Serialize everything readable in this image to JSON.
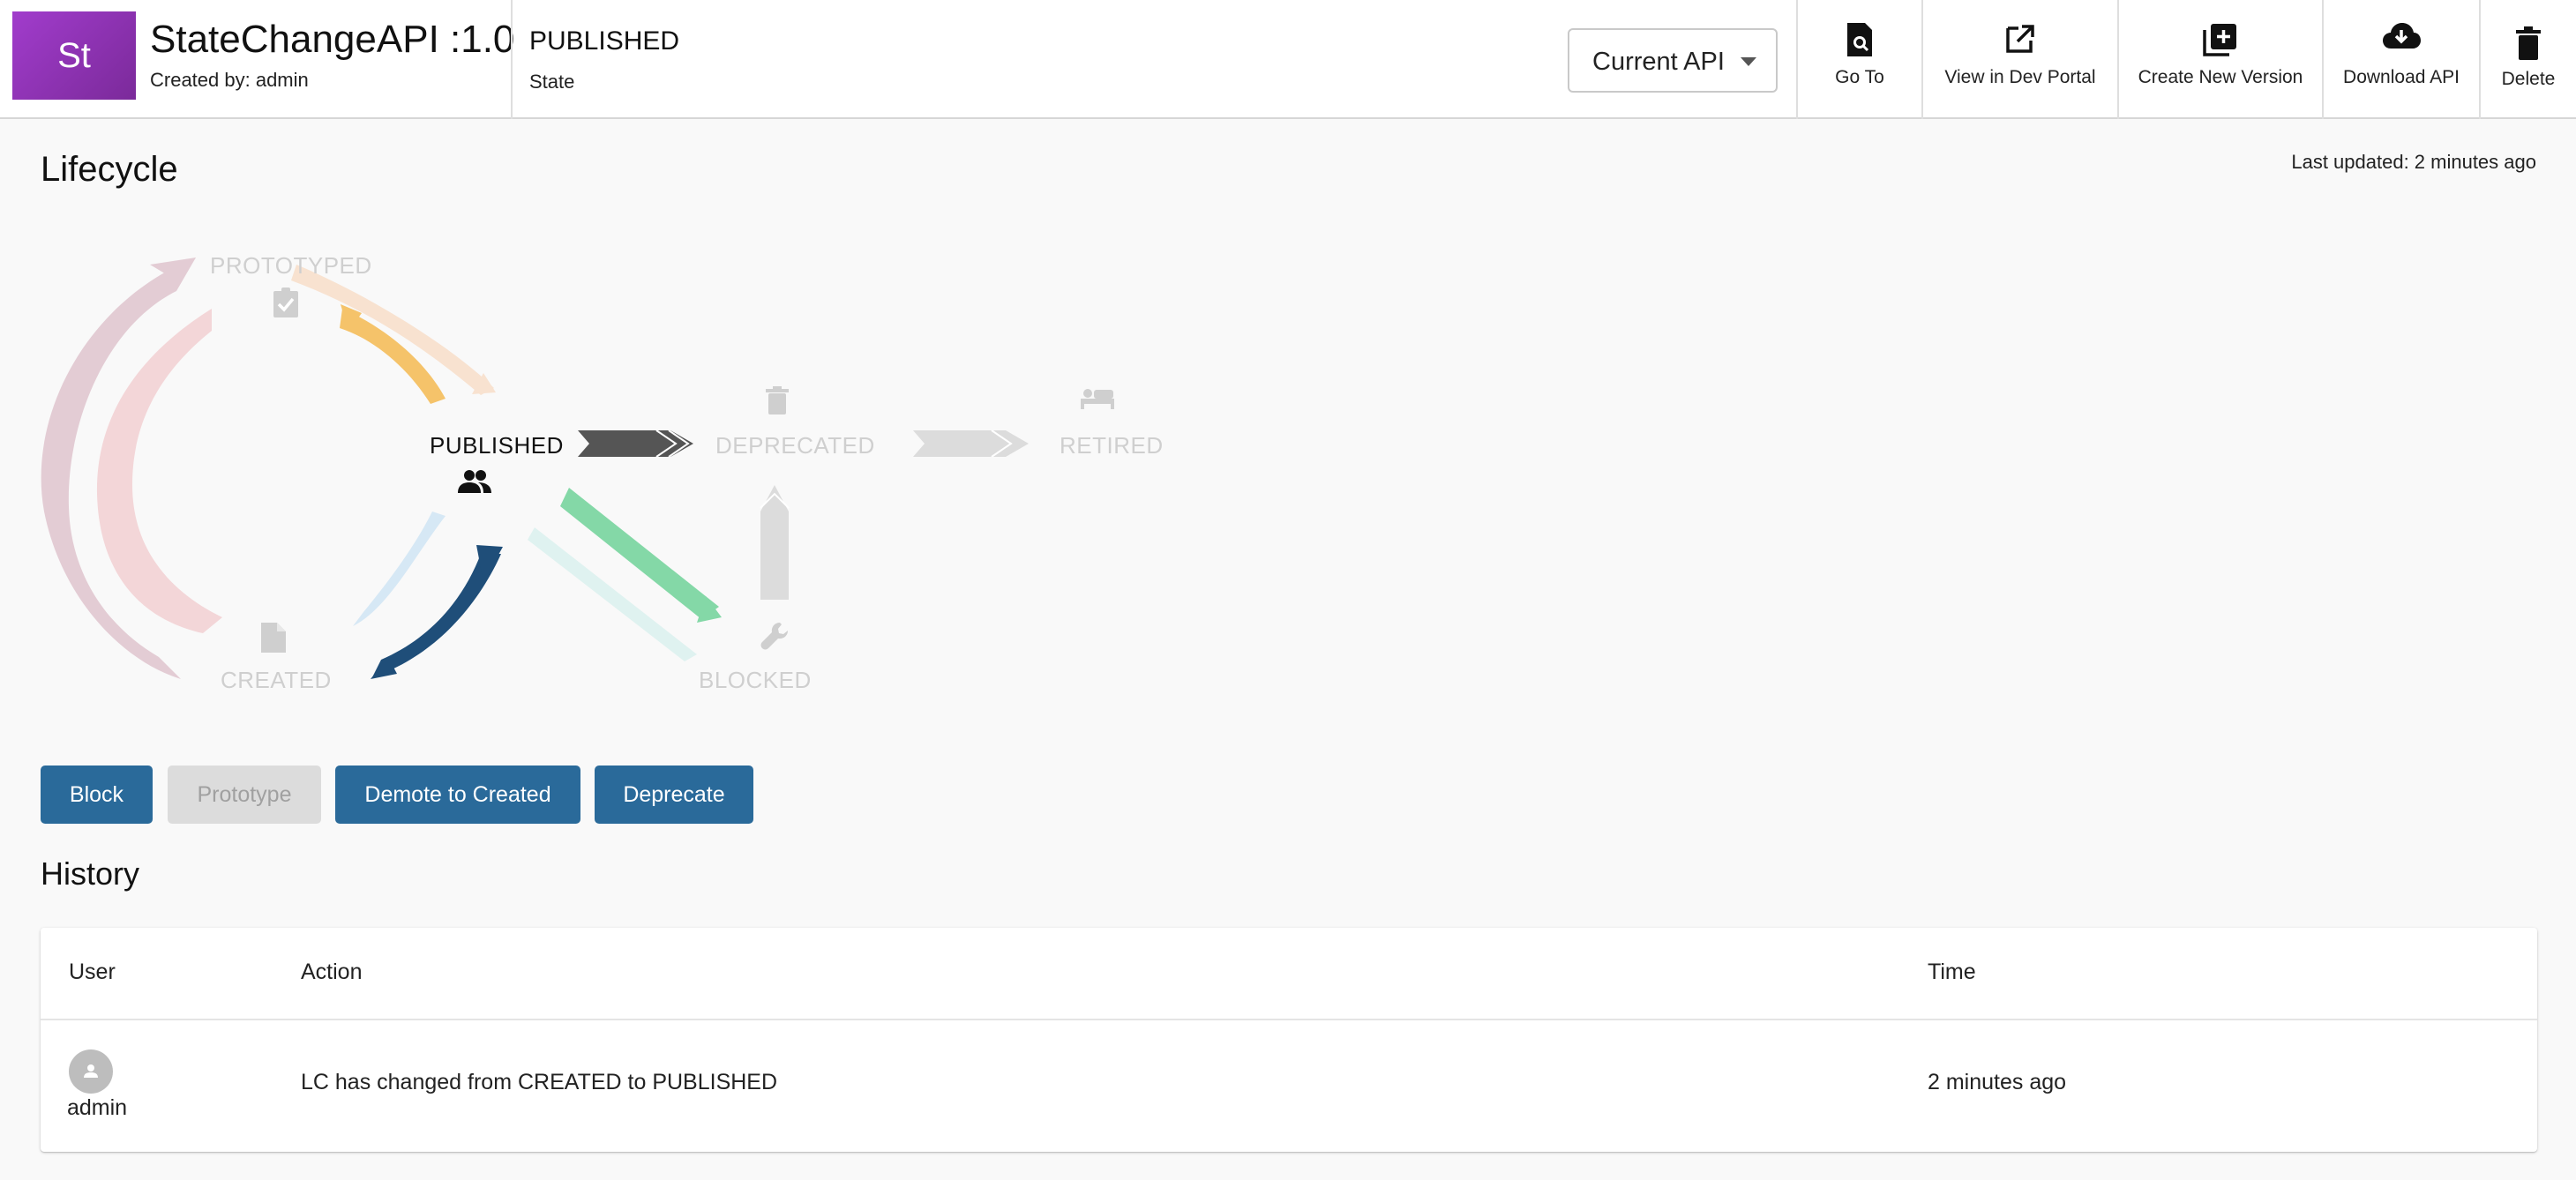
{
  "header": {
    "avatar_text": "St",
    "api_name": "StateChangeAPI :1.0",
    "created_by": "Created by: admin",
    "state_value": "PUBLISHED",
    "state_label": "State",
    "api_select_value": "Current API",
    "actions": [
      {
        "label": "Go To",
        "icon": "search-document-icon"
      },
      {
        "label": "View in Dev Portal",
        "icon": "external-link-icon"
      },
      {
        "label": "Create New Version",
        "icon": "add-box-icon"
      },
      {
        "label": "Download API",
        "icon": "cloud-download-icon"
      },
      {
        "label": "Delete",
        "icon": "trash-icon"
      }
    ]
  },
  "lifecycle": {
    "title": "Lifecycle",
    "last_updated": "Last updated: 2 minutes ago",
    "current_state": "PUBLISHED",
    "states": {
      "prototyped": "PROTOTYPED",
      "published": "PUBLISHED",
      "deprecated": "DEPRECATED",
      "retired": "RETIRED",
      "created": "CREATED",
      "blocked": "BLOCKED"
    },
    "colors": {
      "active_text": "#111111",
      "inactive_text": "#cfcfcf",
      "publish_to_deprecate": "#555555",
      "demote_to_created": "#1f4e79",
      "block": "#84d8a7",
      "prototype": "#f5c36a"
    }
  },
  "buttons": {
    "block": "Block",
    "prototype": "Prototype",
    "demote": "Demote to Created",
    "deprecate": "Deprecate"
  },
  "history": {
    "title": "History",
    "columns": [
      "User",
      "Action",
      "Time"
    ],
    "rows": [
      {
        "user": "admin",
        "action": "LC has changed from CREATED to PUBLISHED",
        "time": "2 minutes ago"
      }
    ]
  }
}
